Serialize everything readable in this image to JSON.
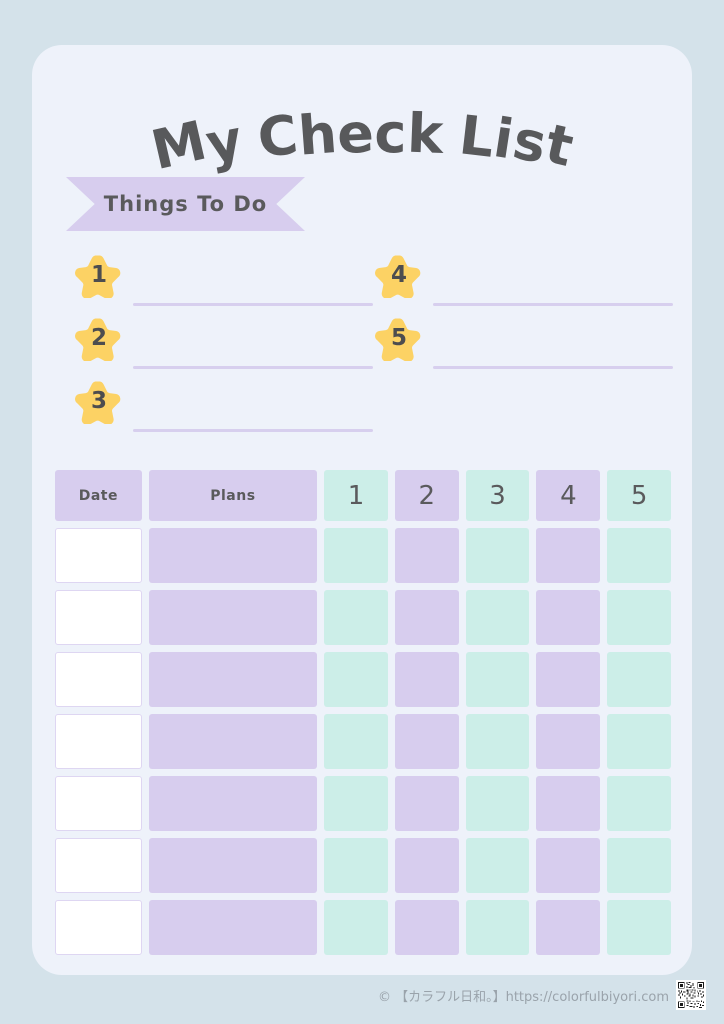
{
  "page": {
    "title_text": "My Check List",
    "title_letters": [
      "M",
      "y",
      " ",
      "C",
      "h",
      "e",
      "c",
      "k",
      " ",
      "L",
      "i",
      "s",
      "t"
    ],
    "background_color": "#d4e2ea",
    "card_color": "#eef2fa"
  },
  "ribbon": {
    "label": "Things To Do",
    "color": "#d7cdee"
  },
  "todo": {
    "items": [
      {
        "number": "1",
        "column": "left",
        "row": 0
      },
      {
        "number": "2",
        "column": "left",
        "row": 1
      },
      {
        "number": "3",
        "column": "left",
        "row": 2
      },
      {
        "number": "4",
        "column": "right",
        "row": 0
      },
      {
        "number": "5",
        "column": "right",
        "row": 1
      }
    ],
    "star_color": "#fcd264",
    "star_color_light": "#ffdd85",
    "rule_color": "#d7cfee"
  },
  "table": {
    "headers": {
      "date": "Date",
      "plans": "Plans",
      "checks": [
        "1",
        "2",
        "3",
        "4",
        "5"
      ]
    },
    "check_colors": [
      "mint",
      "purple",
      "mint",
      "purple",
      "mint"
    ],
    "row_count": 7,
    "rows": [
      {
        "date": "",
        "plans": "",
        "checks": [
          "",
          "",
          "",
          "",
          ""
        ]
      },
      {
        "date": "",
        "plans": "",
        "checks": [
          "",
          "",
          "",
          "",
          ""
        ]
      },
      {
        "date": "",
        "plans": "",
        "checks": [
          "",
          "",
          "",
          "",
          ""
        ]
      },
      {
        "date": "",
        "plans": "",
        "checks": [
          "",
          "",
          "",
          "",
          ""
        ]
      },
      {
        "date": "",
        "plans": "",
        "checks": [
          "",
          "",
          "",
          "",
          ""
        ]
      },
      {
        "date": "",
        "plans": "",
        "checks": [
          "",
          "",
          "",
          "",
          ""
        ]
      },
      {
        "date": "",
        "plans": "",
        "checks": [
          "",
          "",
          "",
          "",
          ""
        ]
      }
    ],
    "colors": {
      "purple": "#d7cdee",
      "mint": "#cceee8",
      "date_cell": "#ffffff"
    }
  },
  "footer": {
    "credit": "© 【カラフル日和。】https://colorfulbiyori.com",
    "qr_label": "qr-code"
  }
}
